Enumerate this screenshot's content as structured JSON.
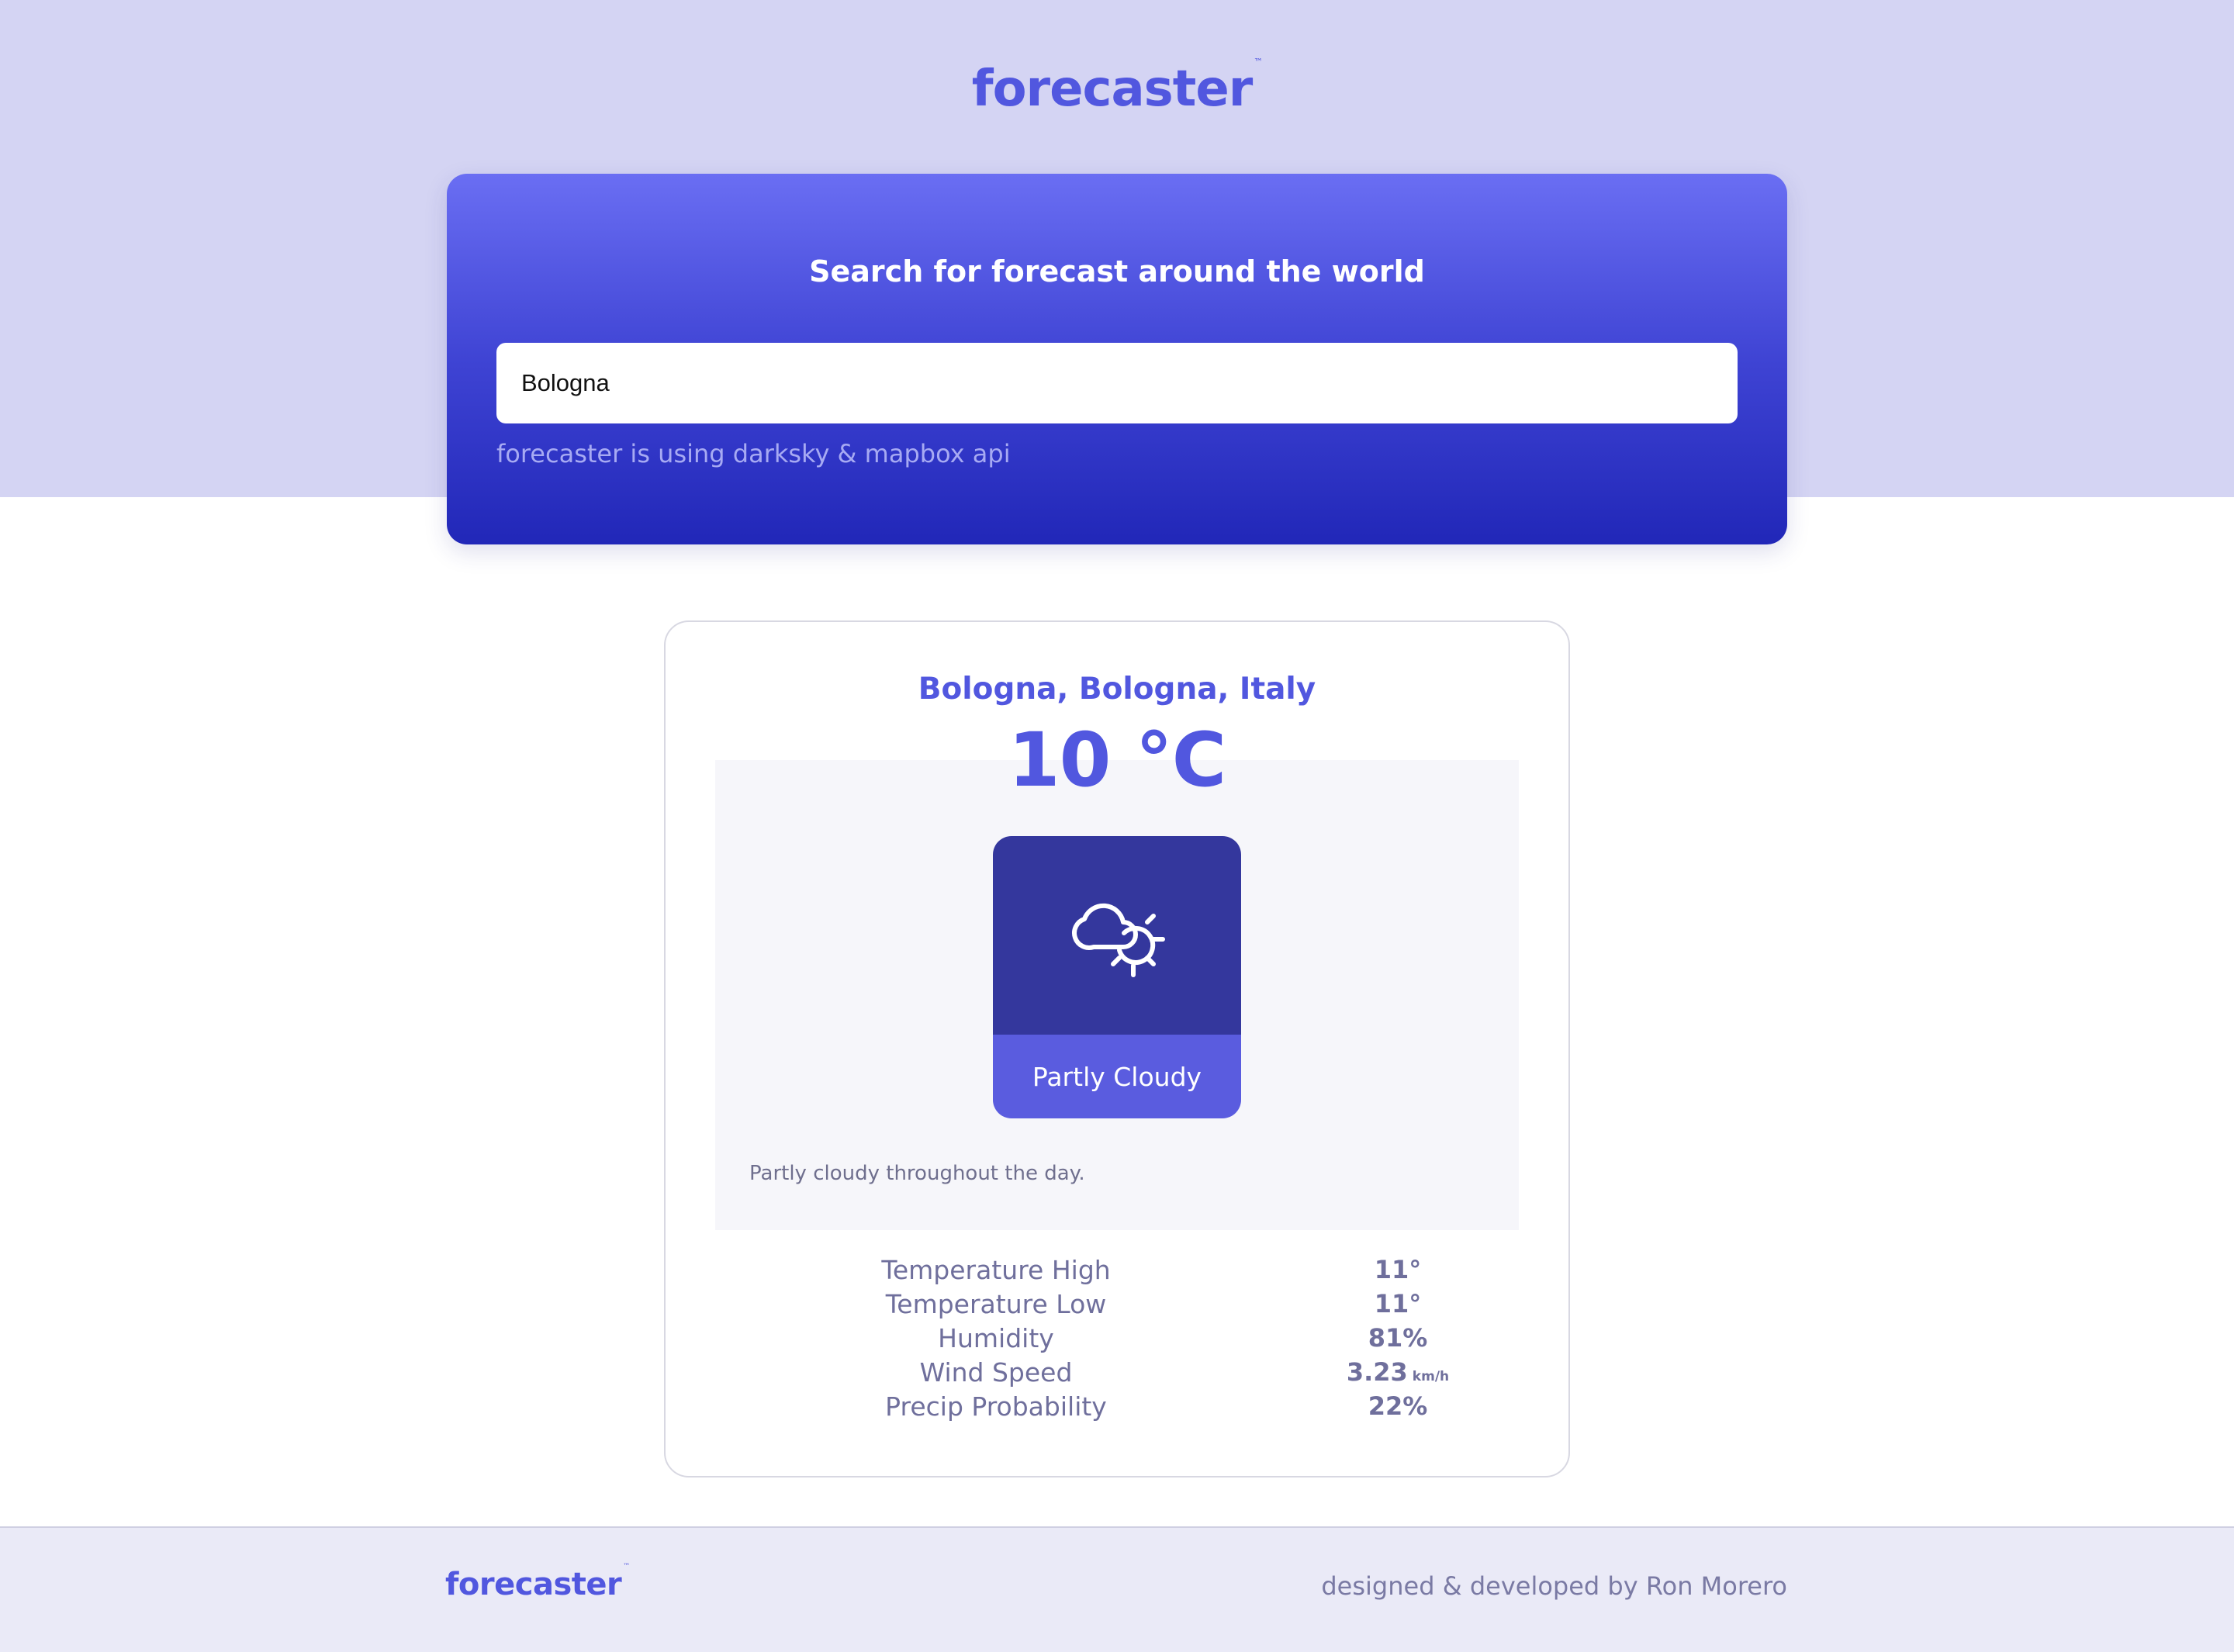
{
  "brand": {
    "name": "forecaster",
    "trademark": "™",
    "color": "#5157df"
  },
  "search": {
    "title": "Search for forecast around the world",
    "value": "Bologna",
    "note": "forecaster is using darksky & mapbox api"
  },
  "forecast": {
    "location": "Bologna, Bologna, Italy",
    "temperature": "10 °C",
    "icon": "partly-cloudy-day-icon",
    "condition": "Partly Cloudy",
    "summary": "Partly cloudy throughout the day.",
    "stats": [
      {
        "label": "Temperature High",
        "value": "11°",
        "unit": ""
      },
      {
        "label": "Temperature Low",
        "value": "11°",
        "unit": ""
      },
      {
        "label": "Humidity",
        "value": "81%",
        "unit": ""
      },
      {
        "label": "Wind Speed",
        "value": "3.23",
        "unit": "km/h"
      },
      {
        "label": "Precip Probability",
        "value": "22%",
        "unit": ""
      }
    ]
  },
  "footer": {
    "logo": "forecaster",
    "trademark": "™",
    "credit": "designed & developed by Ron Morero"
  }
}
